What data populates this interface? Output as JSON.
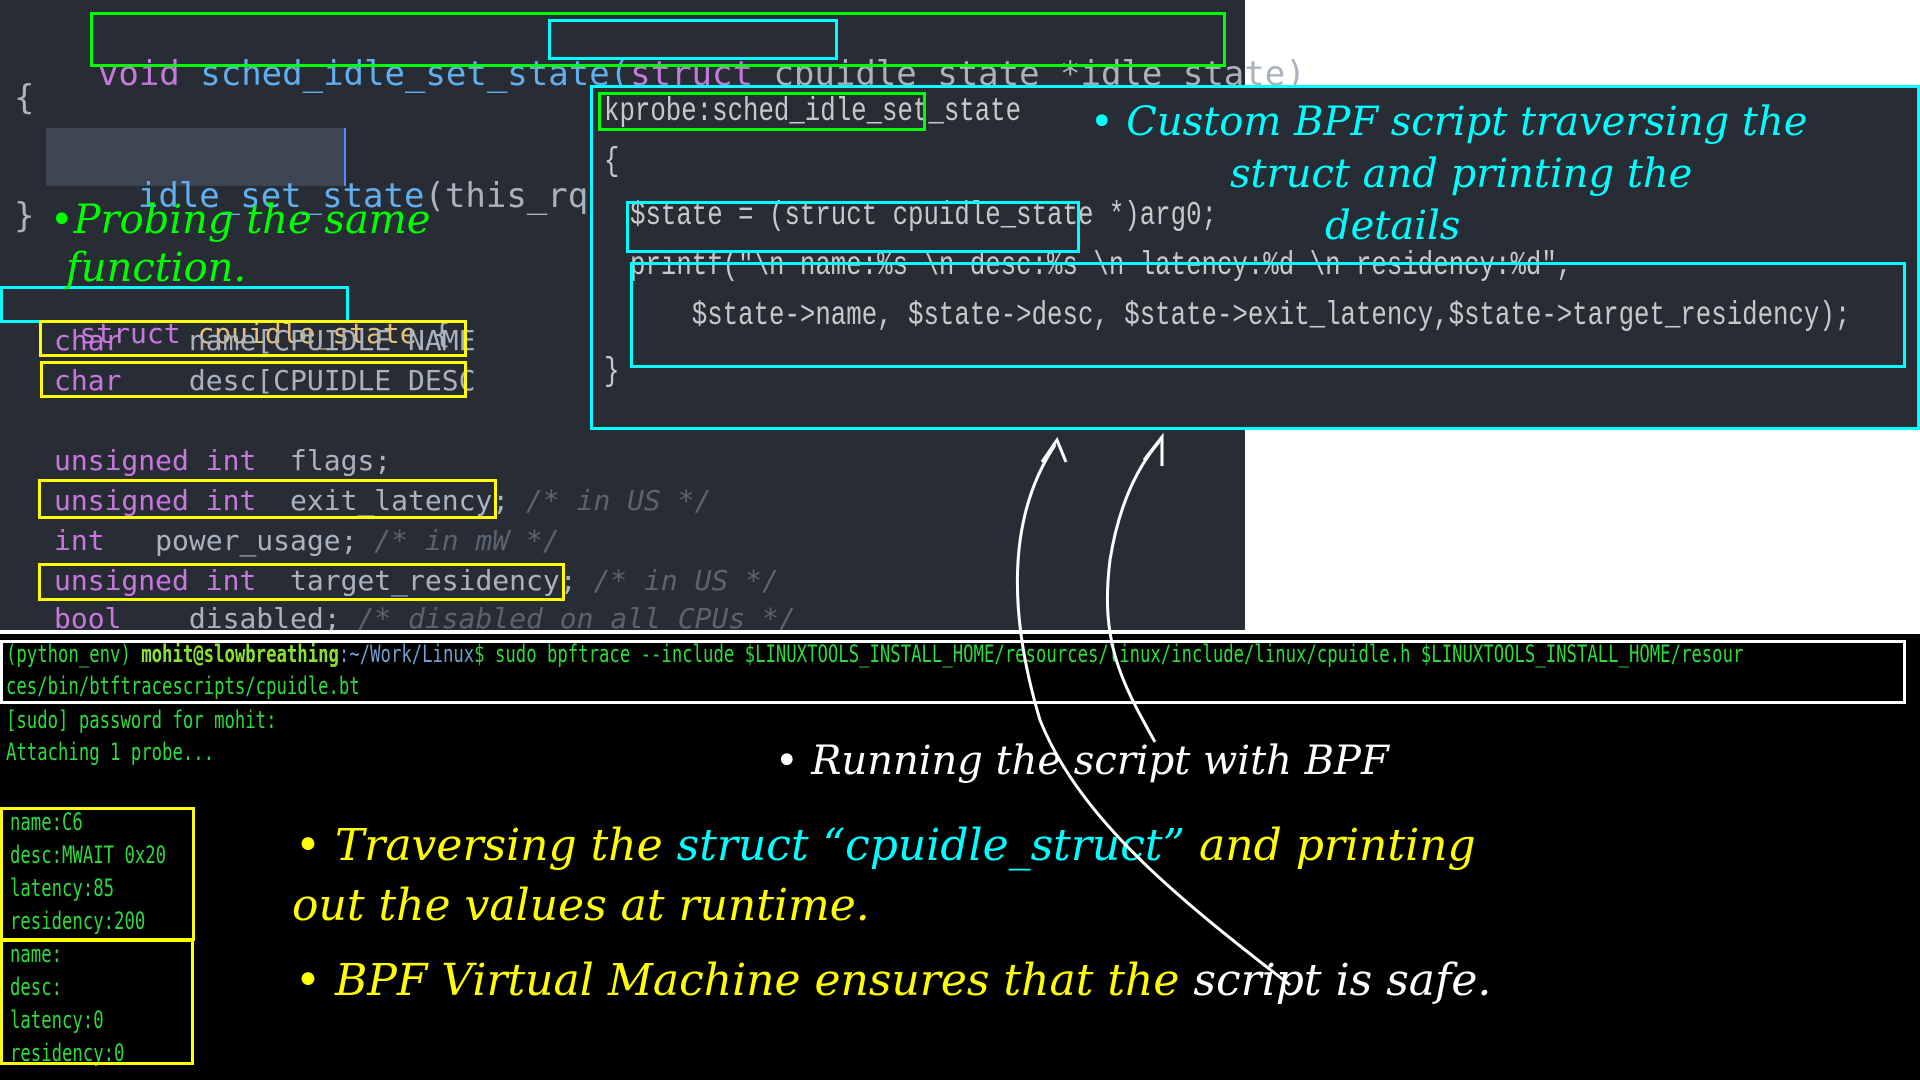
{
  "editor": {
    "signature": {
      "return_type": "void",
      "function_name": "sched_idle_set_state(",
      "param_keyword": "struct",
      "param_type": "cpuidle",
      "param_rest": "_state *idle_state)"
    },
    "open_brace": "{",
    "call_line": {
      "selected": "idle_set_state",
      "rest": "(this_rq(),"
    },
    "close_brace": "}",
    "struct_decl": {
      "keyword": "struct",
      "name": "cpuidle_state",
      "brace": " {"
    },
    "fields": [
      {
        "type": "char",
        "decl": "    name[CPUIDLE_NAME",
        "comment": ""
      },
      {
        "type": "char",
        "decl": "    desc[CPUIDLE_DESC",
        "comment": ""
      },
      {
        "type": "unsigned int",
        "decl": "  flags;",
        "comment": ""
      },
      {
        "type": "unsigned int",
        "decl": "  exit_latency;",
        "comment": " /* in US */"
      },
      {
        "type": "int",
        "decl": "   power_usage;",
        "comment": " /* in mW */"
      },
      {
        "type": "unsigned int",
        "decl": "  target_residency;",
        "comment": " /* in US */"
      },
      {
        "type": "bool",
        "decl": "    disabled;",
        "comment": " /* disabled on all CPUs */"
      }
    ]
  },
  "script": {
    "probe": "kprobe:sched_idle_set_state",
    "open_brace": "{",
    "state_assign": "$state = (struct cpuidle_state *)arg0",
    "semicolon": ";",
    "printf_line1": "printf(\"\\n name:%s \\n desc:%s \\n latency:%d \\n residency:%d\",",
    "printf_line2": "    $state->name, $state->desc, $state->exit_latency,$state->target_residency);",
    "close_brace": "}"
  },
  "terminal": {
    "prompt_env": "(python_env) ",
    "prompt_user": "mohit@slowbreathing",
    "prompt_path": ":~/Work/Linux",
    "prompt_symbol": "$ ",
    "command_line1": "sudo bpftrace --include $LINUXTOOLS_INSTALL_HOME/resources/linux/include/linux/cpuidle.h $LINUXTOOLS_INSTALL_HOME/resour",
    "command_line2": "ces/bin/btftracescripts/cpuidle.bt",
    "sudo_prompt": "[sudo] password for mohit:",
    "attaching": "Attaching 1 probe...",
    "outputs": [
      {
        "name": "name:C6",
        "desc": "desc:MWAIT 0x20",
        "latency": "latency:85",
        "residency": "residency:200"
      },
      {
        "name": "name:",
        "desc": "desc:",
        "latency": "latency:0",
        "residency": "residency:0"
      }
    ]
  },
  "annotations": {
    "probing": [
      "•Probing the same",
      "function."
    ],
    "custom_script": [
      "• Custom BPF script traversing the",
      "struct and printing the",
      "details"
    ],
    "running": "• Running the script with BPF",
    "traversing_a": "• Traversing the ",
    "traversing_b": "struct “cpuidle_struct”",
    "traversing_c": " and printing",
    "traversing_line2": "out the  values  at runtime.",
    "bpf_vm_a": "• BPF Virtual Machine ensures that the ",
    "bpf_vm_b": "script is safe."
  },
  "colors": {
    "green_box": "#00ff00",
    "cyan_box": "#00ffff",
    "yellow_box": "#ffff00",
    "white_annot": "#ffffff"
  }
}
